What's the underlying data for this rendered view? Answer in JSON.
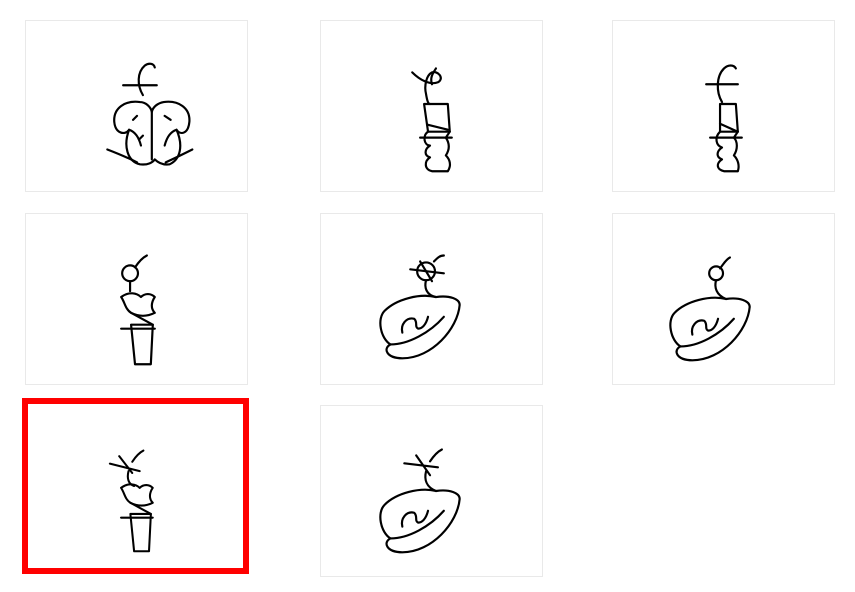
{
  "grid": {
    "selected_index": 6,
    "selection_color": "#ff0000",
    "cards": [
      {
        "glyph": "leaf-head-icon"
      },
      {
        "glyph": "tall-figure-x-top-icon"
      },
      {
        "glyph": "tall-figure-hook-top-icon"
      },
      {
        "glyph": "circle-top-column-icon"
      },
      {
        "glyph": "crossed-circle-blob-icon"
      },
      {
        "glyph": "circle-blob-icon"
      },
      {
        "glyph": "x-top-column-icon"
      },
      {
        "glyph": "x-top-blob-icon"
      }
    ]
  }
}
